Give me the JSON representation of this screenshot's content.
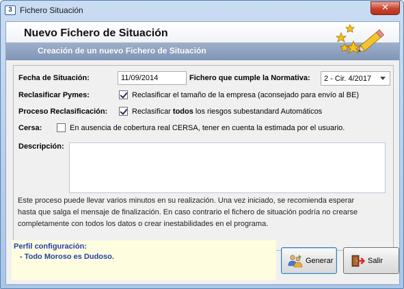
{
  "window": {
    "title": "Fichero Situación",
    "close_glyph": "✕",
    "app_icon_glyph": "3"
  },
  "header": {
    "title": "Nuevo Fichero de Situación",
    "subtitle": "Creación de un nuevo Fichero de Situación",
    "art_icon": "stars-pencil-icon"
  },
  "form": {
    "fecha_label": "Fecha de Situación:",
    "fecha_value": "11/09/2014",
    "normativa_label": "Fichero que cumple la Normativa:",
    "normativa_value": "2 - Cir. 4/2017",
    "pymes_label": "Reclasificar Pymes:",
    "pymes_checked": true,
    "pymes_text": "Reclasificar el tamaño de la empresa (aconsejado para envío al BE)",
    "proceso_label": "Proceso Reclasificación:",
    "proceso_checked": true,
    "proceso_text_pre": "Reclasificar ",
    "proceso_text_bold": "todos",
    "proceso_text_post": " los riesgos subestandard Automáticos",
    "cersa_label": "Cersa:",
    "cersa_checked": false,
    "cersa_text": "En ausencia de cobertura real CERSA, tener en cuenta la estimada por el usuario.",
    "descripcion_label": "Descripción:",
    "descripcion_value": "",
    "info_lines": [
      "Este proceso puede llevar varios minutos en su realización. Una vez iniciado, se recomienda esperar",
      "hasta que salga el mensaje de finalización. En caso contrario el fichero de situación podría no crearse",
      "completamente con todos los datos o crear inestabilidades en el programa."
    ]
  },
  "profile": {
    "title": "Perfil configuración:",
    "item": "- Todo Moroso es Dudoso."
  },
  "buttons": {
    "generar_label": "Generar",
    "generar_icon": "users-generate-icon",
    "salir_label": "Salir",
    "salir_icon": "exit-door-icon"
  }
}
